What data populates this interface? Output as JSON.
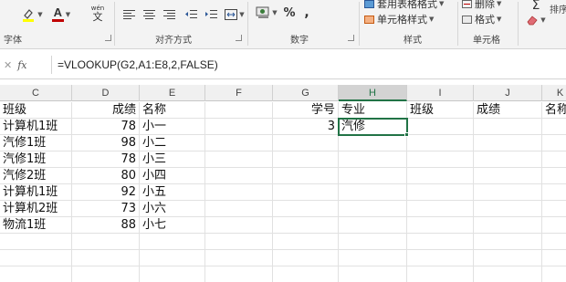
{
  "ribbon": {
    "font_group_label": "字体",
    "alignment_group_label": "对齐方式",
    "number_group_label": "数字",
    "styles_group_label": "样式",
    "cells_group_label": "单元格",
    "editing_group_label": "排序",
    "font_color": "#c00000",
    "highlight_color": "#ffff00",
    "number_percent": "%",
    "number_comma": ",",
    "table_format_label": "套用表格格式",
    "cell_styles_label": "单元格样式",
    "delete_label": "删除",
    "format_label": "格式",
    "font_color_letter": "A",
    "wen_label": "wén",
    "wen_char": "文"
  },
  "formula_bar": {
    "fx_label": "fx",
    "formula": "=VLOOKUP(G2,A1:E8,2,FALSE)"
  },
  "grid": {
    "columns": [
      "C",
      "D",
      "E",
      "F",
      "G",
      "H",
      "I",
      "J",
      "K"
    ],
    "rows": [
      [
        "班级",
        "成绩",
        "名称",
        "",
        "学号",
        "专业",
        "班级",
        "成绩",
        "名称"
      ],
      [
        "计算机1班",
        "78",
        "小一",
        "",
        "3",
        "汽修",
        "",
        "",
        ""
      ],
      [
        "汽修1班",
        "98",
        "小二",
        "",
        "",
        "",
        "",
        "",
        ""
      ],
      [
        "汽修1班",
        "78",
        "小三",
        "",
        "",
        "",
        "",
        "",
        ""
      ],
      [
        "汽修2班",
        "80",
        "小四",
        "",
        "",
        "",
        "",
        "",
        ""
      ],
      [
        "计算机1班",
        "92",
        "小五",
        "",
        "",
        "",
        "",
        "",
        ""
      ],
      [
        "计算机2班",
        "73",
        "小六",
        "",
        "",
        "",
        "",
        "",
        ""
      ],
      [
        "物流1班",
        "88",
        "小七",
        "",
        "",
        "",
        "",
        "",
        ""
      ],
      [
        "",
        "",
        "",
        "",
        "",
        "",
        "",
        "",
        ""
      ],
      [
        "",
        "",
        "",
        "",
        "",
        "",
        "",
        "",
        ""
      ],
      [
        "",
        "",
        "",
        "",
        "",
        "",
        "",
        "",
        ""
      ]
    ]
  }
}
